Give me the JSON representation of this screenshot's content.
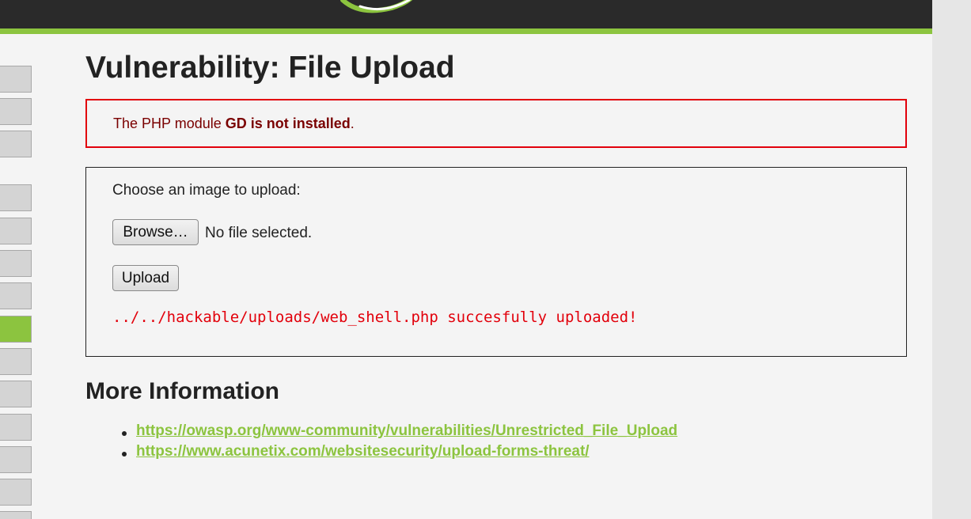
{
  "page": {
    "title": "Vulnerability: File Upload"
  },
  "warning": {
    "prefix": "The PHP module ",
    "bold": "GD is not installed",
    "suffix": "."
  },
  "upload_form": {
    "choose_label": "Choose an image to upload:",
    "browse_label": "Browse…",
    "file_status": "No file selected.",
    "upload_label": "Upload",
    "result_message": "../../hackable/uploads/web_shell.php succesfully uploaded!"
  },
  "more_info": {
    "title": "More Information",
    "links": [
      "https://owasp.org/www-community/vulnerabilities/Unrestricted_File_Upload",
      "https://www.acunetix.com/websitesecurity/upload-forms-threat/"
    ]
  },
  "colors": {
    "accent": "#8cc43f",
    "header_bg": "#2a2a2a",
    "error_red": "#e2000b",
    "warning_text": "#7a0000"
  },
  "icons": {
    "logo": "dvwa-logo-swirl"
  }
}
